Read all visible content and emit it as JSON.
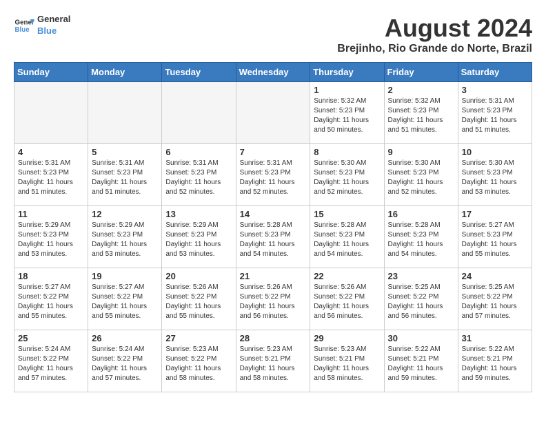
{
  "header": {
    "logo_line1": "General",
    "logo_line2": "Blue",
    "title": "August 2024",
    "subtitle": "Brejinho, Rio Grande do Norte, Brazil"
  },
  "weekdays": [
    "Sunday",
    "Monday",
    "Tuesday",
    "Wednesday",
    "Thursday",
    "Friday",
    "Saturday"
  ],
  "weeks": [
    [
      {
        "day": "",
        "info": ""
      },
      {
        "day": "",
        "info": ""
      },
      {
        "day": "",
        "info": ""
      },
      {
        "day": "",
        "info": ""
      },
      {
        "day": "1",
        "info": "Sunrise: 5:32 AM\nSunset: 5:23 PM\nDaylight: 11 hours and 50 minutes."
      },
      {
        "day": "2",
        "info": "Sunrise: 5:32 AM\nSunset: 5:23 PM\nDaylight: 11 hours and 51 minutes."
      },
      {
        "day": "3",
        "info": "Sunrise: 5:31 AM\nSunset: 5:23 PM\nDaylight: 11 hours and 51 minutes."
      }
    ],
    [
      {
        "day": "4",
        "info": "Sunrise: 5:31 AM\nSunset: 5:23 PM\nDaylight: 11 hours and 51 minutes."
      },
      {
        "day": "5",
        "info": "Sunrise: 5:31 AM\nSunset: 5:23 PM\nDaylight: 11 hours and 51 minutes."
      },
      {
        "day": "6",
        "info": "Sunrise: 5:31 AM\nSunset: 5:23 PM\nDaylight: 11 hours and 52 minutes."
      },
      {
        "day": "7",
        "info": "Sunrise: 5:31 AM\nSunset: 5:23 PM\nDaylight: 11 hours and 52 minutes."
      },
      {
        "day": "8",
        "info": "Sunrise: 5:30 AM\nSunset: 5:23 PM\nDaylight: 11 hours and 52 minutes."
      },
      {
        "day": "9",
        "info": "Sunrise: 5:30 AM\nSunset: 5:23 PM\nDaylight: 11 hours and 52 minutes."
      },
      {
        "day": "10",
        "info": "Sunrise: 5:30 AM\nSunset: 5:23 PM\nDaylight: 11 hours and 53 minutes."
      }
    ],
    [
      {
        "day": "11",
        "info": "Sunrise: 5:29 AM\nSunset: 5:23 PM\nDaylight: 11 hours and 53 minutes."
      },
      {
        "day": "12",
        "info": "Sunrise: 5:29 AM\nSunset: 5:23 PM\nDaylight: 11 hours and 53 minutes."
      },
      {
        "day": "13",
        "info": "Sunrise: 5:29 AM\nSunset: 5:23 PM\nDaylight: 11 hours and 53 minutes."
      },
      {
        "day": "14",
        "info": "Sunrise: 5:28 AM\nSunset: 5:23 PM\nDaylight: 11 hours and 54 minutes."
      },
      {
        "day": "15",
        "info": "Sunrise: 5:28 AM\nSunset: 5:23 PM\nDaylight: 11 hours and 54 minutes."
      },
      {
        "day": "16",
        "info": "Sunrise: 5:28 AM\nSunset: 5:23 PM\nDaylight: 11 hours and 54 minutes."
      },
      {
        "day": "17",
        "info": "Sunrise: 5:27 AM\nSunset: 5:23 PM\nDaylight: 11 hours and 55 minutes."
      }
    ],
    [
      {
        "day": "18",
        "info": "Sunrise: 5:27 AM\nSunset: 5:22 PM\nDaylight: 11 hours and 55 minutes."
      },
      {
        "day": "19",
        "info": "Sunrise: 5:27 AM\nSunset: 5:22 PM\nDaylight: 11 hours and 55 minutes."
      },
      {
        "day": "20",
        "info": "Sunrise: 5:26 AM\nSunset: 5:22 PM\nDaylight: 11 hours and 55 minutes."
      },
      {
        "day": "21",
        "info": "Sunrise: 5:26 AM\nSunset: 5:22 PM\nDaylight: 11 hours and 56 minutes."
      },
      {
        "day": "22",
        "info": "Sunrise: 5:26 AM\nSunset: 5:22 PM\nDaylight: 11 hours and 56 minutes."
      },
      {
        "day": "23",
        "info": "Sunrise: 5:25 AM\nSunset: 5:22 PM\nDaylight: 11 hours and 56 minutes."
      },
      {
        "day": "24",
        "info": "Sunrise: 5:25 AM\nSunset: 5:22 PM\nDaylight: 11 hours and 57 minutes."
      }
    ],
    [
      {
        "day": "25",
        "info": "Sunrise: 5:24 AM\nSunset: 5:22 PM\nDaylight: 11 hours and 57 minutes."
      },
      {
        "day": "26",
        "info": "Sunrise: 5:24 AM\nSunset: 5:22 PM\nDaylight: 11 hours and 57 minutes."
      },
      {
        "day": "27",
        "info": "Sunrise: 5:23 AM\nSunset: 5:22 PM\nDaylight: 11 hours and 58 minutes."
      },
      {
        "day": "28",
        "info": "Sunrise: 5:23 AM\nSunset: 5:21 PM\nDaylight: 11 hours and 58 minutes."
      },
      {
        "day": "29",
        "info": "Sunrise: 5:23 AM\nSunset: 5:21 PM\nDaylight: 11 hours and 58 minutes."
      },
      {
        "day": "30",
        "info": "Sunrise: 5:22 AM\nSunset: 5:21 PM\nDaylight: 11 hours and 59 minutes."
      },
      {
        "day": "31",
        "info": "Sunrise: 5:22 AM\nSunset: 5:21 PM\nDaylight: 11 hours and 59 minutes."
      }
    ]
  ]
}
